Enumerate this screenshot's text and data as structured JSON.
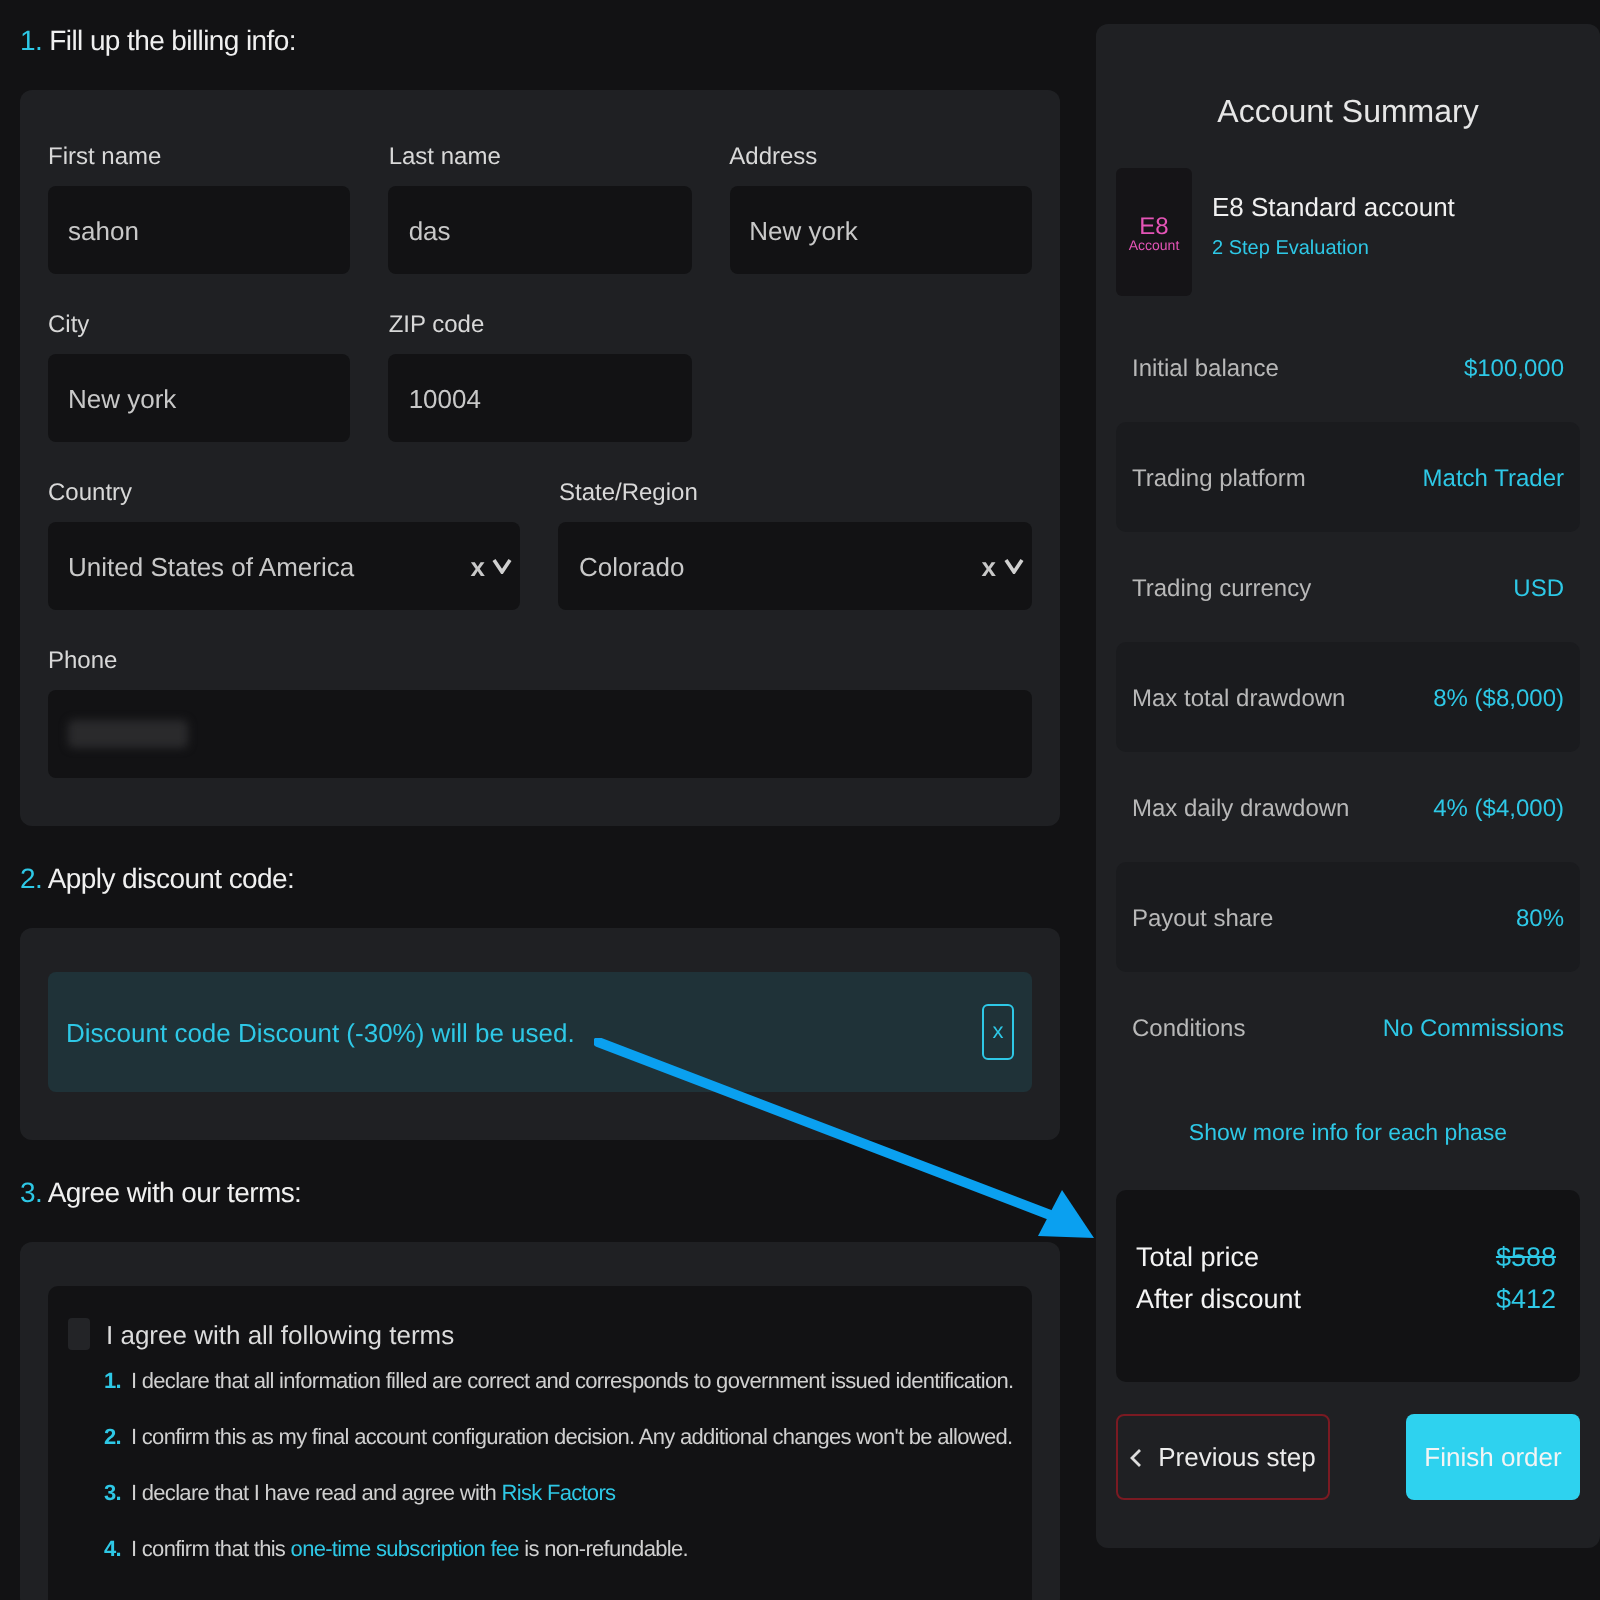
{
  "billing": {
    "number": "1.",
    "title": "Fill up the billing info:",
    "fields": [
      {
        "label": "First name",
        "value": "sahon",
        "kind": "text"
      },
      {
        "label": "Last name",
        "value": "das",
        "kind": "text"
      },
      {
        "label": "Address",
        "value": "New york",
        "kind": "text"
      },
      {
        "label": "City",
        "value": "New york",
        "kind": "text"
      },
      {
        "label": "ZIP code",
        "value": "10004",
        "kind": "text"
      },
      {
        "label": "Country",
        "value": "United States of America",
        "kind": "select",
        "clear": "x"
      },
      {
        "label": "State/Region",
        "value": "Colorado",
        "kind": "select",
        "clear": "x"
      },
      {
        "label": "Phone",
        "kind": "redacted"
      }
    ]
  },
  "discount": {
    "number": "2.",
    "title": "Apply discount code:",
    "message": "Discount code Discount (-30%) will be used.",
    "close": "x"
  },
  "terms": {
    "number": "3.",
    "title": "Agree with our terms:",
    "checkbox_label": "I agree with all following terms",
    "checked": false,
    "items": [
      {
        "number": "1.",
        "parts": [
          {
            "text": "I declare that all information filled are correct and corresponds to government issued identification."
          }
        ]
      },
      {
        "number": "2.",
        "parts": [
          {
            "text": "I confirm this as my final account configuration decision. Any additional changes won't be allowed."
          }
        ]
      },
      {
        "number": "3.",
        "parts": [
          {
            "text": "I declare that I have read and agree with "
          },
          {
            "link": "Risk Factors"
          }
        ]
      },
      {
        "number": "4.",
        "parts": [
          {
            "text": "I confirm that this "
          },
          {
            "link": "one-time subscription fee"
          },
          {
            "text": " is non-refundable."
          }
        ]
      }
    ]
  },
  "summary": {
    "title": "Account Summary",
    "logo": {
      "top": "E8",
      "bottom": "Account"
    },
    "account_name": "E8 Standard account",
    "account_type": "2 Step Evaluation",
    "rows": [
      {
        "label": "Initial balance",
        "value": "$100,000"
      },
      {
        "label": "Trading platform",
        "value": "Match Trader"
      },
      {
        "label": "Trading currency",
        "value": "USD"
      },
      {
        "label": "Max total drawdown",
        "value": "8% ($8,000)"
      },
      {
        "label": "Max daily drawdown",
        "value": "4% ($4,000)"
      },
      {
        "label": "Payout share",
        "value": "80%"
      },
      {
        "label": "Conditions",
        "value": "No Commissions"
      }
    ],
    "more_link": "Show more info for each phase",
    "prices": [
      {
        "label": "Total price",
        "value": "$588",
        "struck": true
      },
      {
        "label": "After discount",
        "value": "$412",
        "struck": false
      }
    ],
    "buttons": [
      {
        "label": "Previous step",
        "kind": "back"
      },
      {
        "label": "Finish order",
        "kind": "primary"
      }
    ]
  }
}
